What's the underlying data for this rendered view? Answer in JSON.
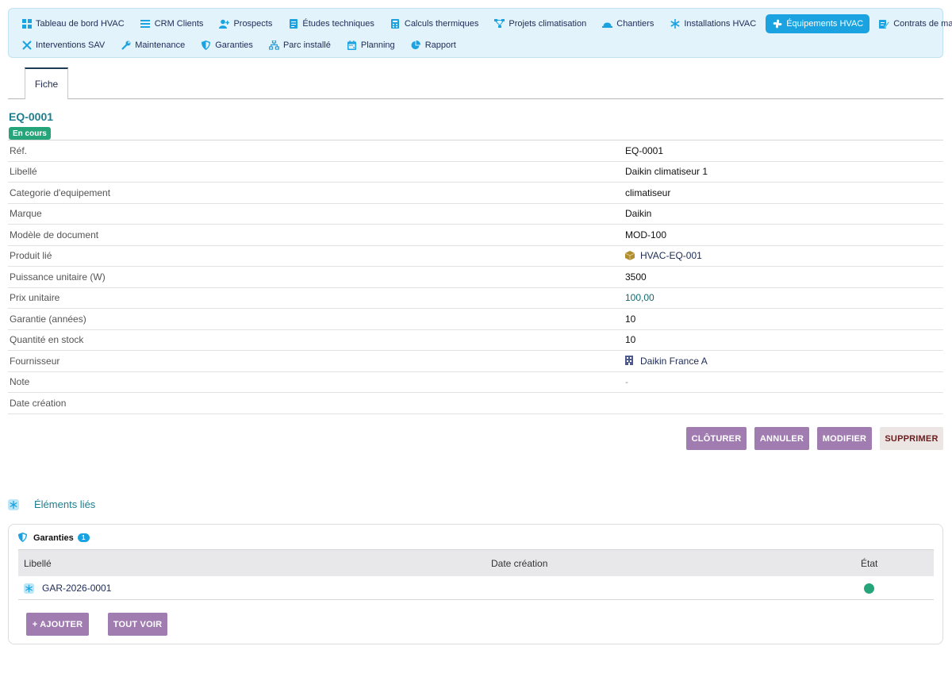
{
  "nav": {
    "row1": [
      {
        "label": "Tableau de bord HVAC",
        "icon": "dashboard-grid-icon"
      },
      {
        "label": "CRM Clients",
        "icon": "list-icon"
      },
      {
        "label": "Prospects",
        "icon": "user-plus-icon"
      },
      {
        "label": "Études techniques",
        "icon": "document-icon"
      },
      {
        "label": "Calculs thermiques",
        "icon": "calculator-icon"
      },
      {
        "label": "Projets climatisation",
        "icon": "project-tree-icon"
      },
      {
        "label": "Chantiers",
        "icon": "helmet-icon"
      },
      {
        "label": "Installations HVAC",
        "icon": "snowflake-icon"
      },
      {
        "label": "Équipements HVAC",
        "icon": "fan-icon",
        "active": true
      },
      {
        "label": "Contrats de maintenance",
        "icon": "contract-icon"
      }
    ],
    "row2": [
      {
        "label": "Interventions SAV",
        "icon": "tools-icon"
      },
      {
        "label": "Maintenance",
        "icon": "wrench-icon"
      },
      {
        "label": "Garanties",
        "icon": "shield-icon"
      },
      {
        "label": "Parc installé",
        "icon": "sitemap-icon"
      },
      {
        "label": "Planning",
        "icon": "calendar-icon"
      },
      {
        "label": "Rapport",
        "icon": "pie-chart-icon"
      }
    ]
  },
  "tabs": {
    "fiche": "Fiche"
  },
  "record": {
    "ref": "EQ-0001",
    "status": "En cours"
  },
  "fields": [
    {
      "label": "Réf.",
      "value": "EQ-0001"
    },
    {
      "label": "Libellé",
      "value": "Daikin climatiseur 1"
    },
    {
      "label": "Categorie d'equipement",
      "value": "climatiseur"
    },
    {
      "label": "Marque",
      "value": "Daikin"
    },
    {
      "label": "Modèle de document",
      "value": "MOD-100"
    },
    {
      "label": "Produit lié",
      "value": "HVAC-EQ-001"
    },
    {
      "label": "Puissance unitaire (W)",
      "value": "3500"
    },
    {
      "label": "Prix unitaire",
      "value": "100,00"
    },
    {
      "label": "Garantie (années)",
      "value": "10"
    },
    {
      "label": "Quantité en stock",
      "value": "10"
    },
    {
      "label": "Fournisseur",
      "value": "Daikin France A"
    },
    {
      "label": "Note",
      "value": "-"
    },
    {
      "label": "Date création",
      "value": ""
    }
  ],
  "actions": {
    "close": "CLÔTURER",
    "cancel": "ANNULER",
    "edit": "MODIFIER",
    "delete": "SUPPRIMER"
  },
  "linked": {
    "title": "Éléments liés",
    "guarantees": {
      "title": "Garanties",
      "count": "1",
      "columns": {
        "label": "Libellé",
        "date": "Date création",
        "state": "État"
      },
      "rows": [
        {
          "ref": "GAR-2026-0001",
          "date": "",
          "state_color": "#27a57a"
        }
      ],
      "add": "+ AJOUTER",
      "see_all": "TOUT VOIR"
    }
  },
  "colors": {
    "accent": "#1aa3e0",
    "status_green": "#27a57a",
    "button_purple": "#a07cb0",
    "title_teal": "#1e7e8e"
  }
}
